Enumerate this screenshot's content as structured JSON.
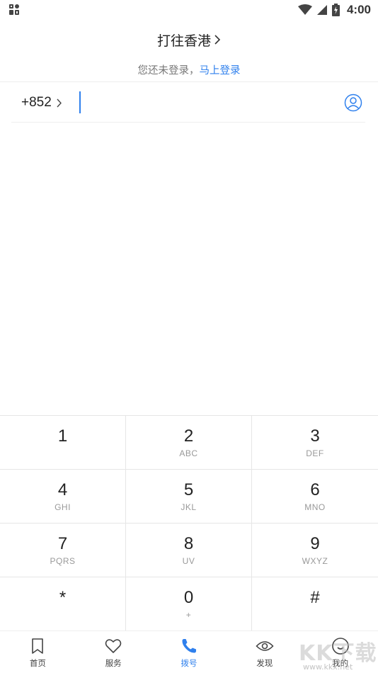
{
  "status_bar": {
    "time": "4:00",
    "icons": [
      "app-notification-icon",
      "wifi-icon",
      "signal-icon",
      "battery-charging-icon"
    ]
  },
  "header": {
    "title": "打往香港",
    "login_prompt": "您还未登录，",
    "login_link": "马上登录"
  },
  "dial_input": {
    "country_code": "+852",
    "value": "",
    "placeholder": ""
  },
  "keypad": {
    "keys": [
      {
        "digit": "1",
        "letters": ""
      },
      {
        "digit": "2",
        "letters": "ABC"
      },
      {
        "digit": "3",
        "letters": "DEF"
      },
      {
        "digit": "4",
        "letters": "GHI"
      },
      {
        "digit": "5",
        "letters": "JKL"
      },
      {
        "digit": "6",
        "letters": "MNO"
      },
      {
        "digit": "7",
        "letters": "PQRS"
      },
      {
        "digit": "8",
        "letters": "UV"
      },
      {
        "digit": "9",
        "letters": "WXYZ"
      },
      {
        "digit": "*",
        "letters": ""
      },
      {
        "digit": "0",
        "letters": "+"
      },
      {
        "digit": "#",
        "letters": ""
      }
    ]
  },
  "bottom_nav": {
    "active": "dial",
    "items": [
      {
        "label": "首页",
        "icon": "bookmark-icon"
      },
      {
        "label": "服务",
        "icon": "heart-icon"
      },
      {
        "label": "拨号",
        "icon": "phone-icon"
      },
      {
        "label": "发现",
        "icon": "eye-icon"
      },
      {
        "label": "我的",
        "icon": "profile-icon"
      }
    ]
  },
  "watermark": {
    "text": "KK下载",
    "url": "www.kkx.net"
  },
  "colors": {
    "accent": "#2f80ed",
    "divider": "#e6e6e6",
    "text_primary": "#222222",
    "text_secondary": "#999999"
  }
}
